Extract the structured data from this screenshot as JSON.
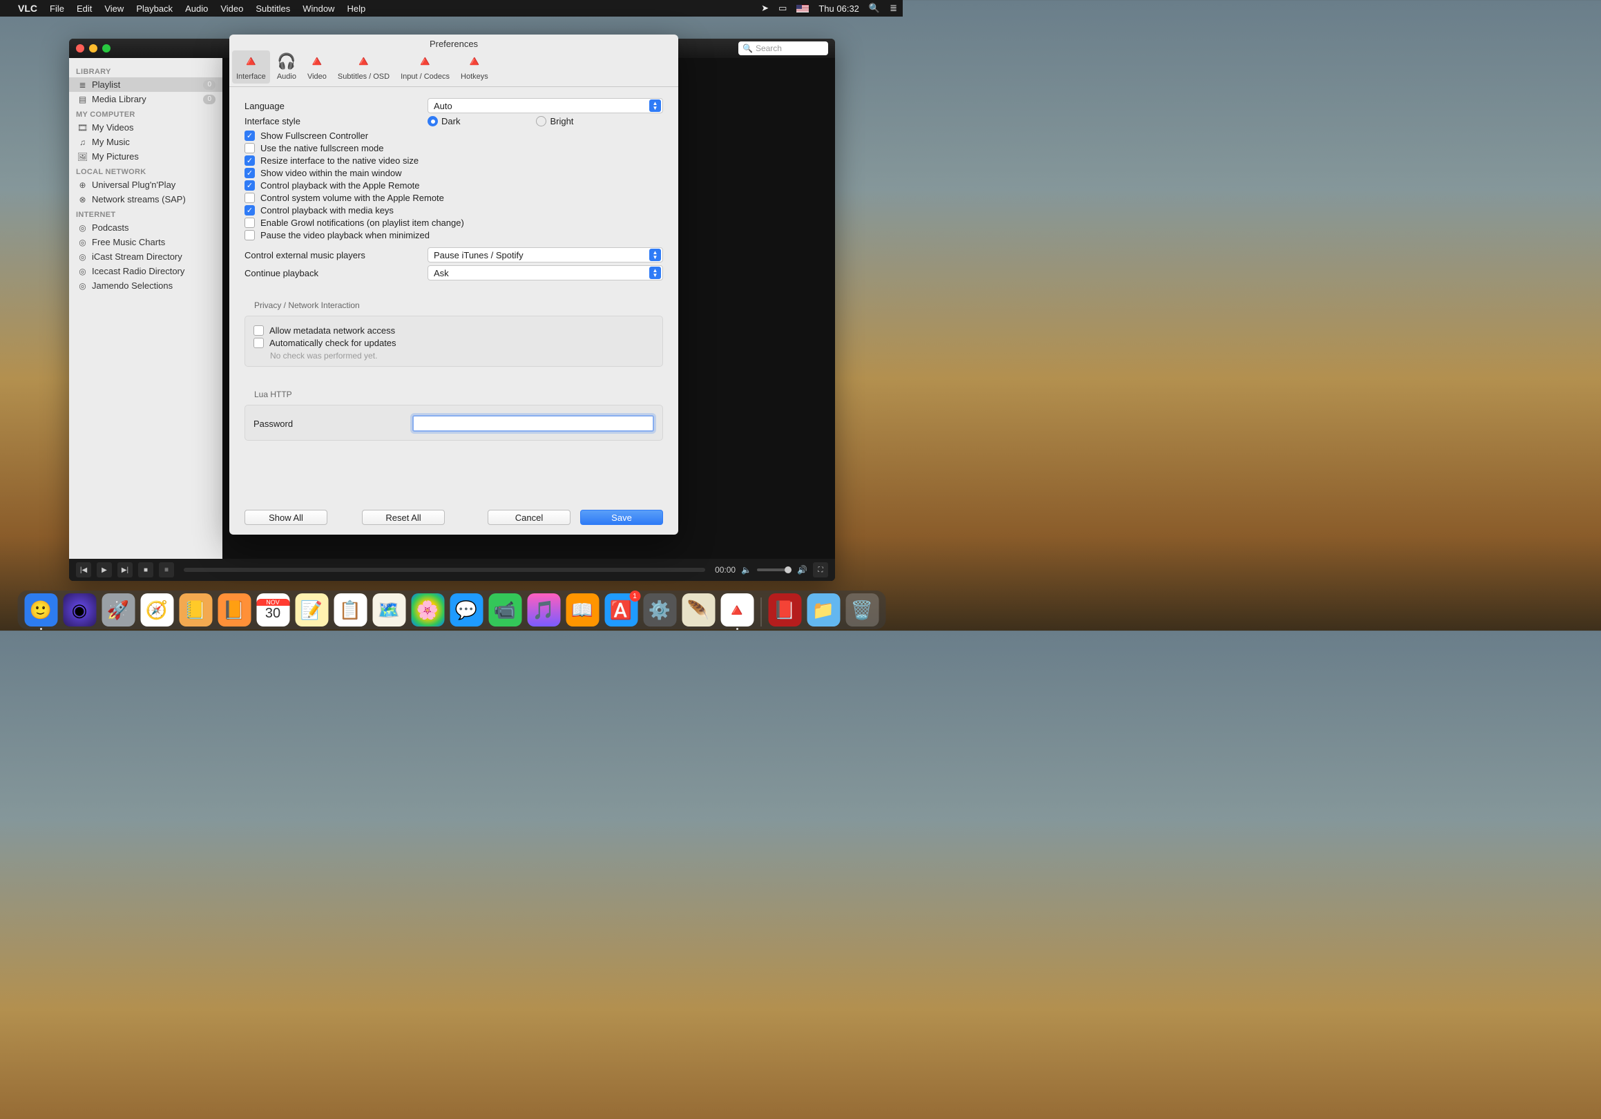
{
  "menubar": {
    "app": "VLC",
    "items": [
      "File",
      "Edit",
      "View",
      "Playback",
      "Audio",
      "Video",
      "Subtitles",
      "Window",
      "Help"
    ],
    "clock": "Thu 06:32"
  },
  "vlc": {
    "search_placeholder": "Search",
    "sidebar": {
      "sections": [
        {
          "header": "LIBRARY",
          "items": [
            {
              "label": "Playlist",
              "icon": "list-icon",
              "badge": "0",
              "selected": true
            },
            {
              "label": "Media Library",
              "icon": "library-icon",
              "badge": "0"
            }
          ]
        },
        {
          "header": "MY COMPUTER",
          "items": [
            {
              "label": "My Videos",
              "icon": "film-icon"
            },
            {
              "label": "My Music",
              "icon": "note-icon"
            },
            {
              "label": "My Pictures",
              "icon": "picture-icon"
            }
          ]
        },
        {
          "header": "LOCAL NETWORK",
          "items": [
            {
              "label": "Universal Plug'n'Play",
              "icon": "upnp-icon"
            },
            {
              "label": "Network streams (SAP)",
              "icon": "network-icon"
            }
          ]
        },
        {
          "header": "INTERNET",
          "items": [
            {
              "label": "Podcasts",
              "icon": "podcast-icon"
            },
            {
              "label": "Free Music Charts",
              "icon": "podcast-icon"
            },
            {
              "label": "iCast Stream Directory",
              "icon": "podcast-icon"
            },
            {
              "label": "Icecast Radio Directory",
              "icon": "podcast-icon"
            },
            {
              "label": "Jamendo Selections",
              "icon": "podcast-icon"
            }
          ]
        }
      ]
    },
    "controls": {
      "time": "00:00"
    }
  },
  "prefs": {
    "title": "Preferences",
    "tabs": [
      {
        "label": "Interface",
        "active": true
      },
      {
        "label": "Audio"
      },
      {
        "label": "Video"
      },
      {
        "label": "Subtitles / OSD"
      },
      {
        "label": "Input / Codecs"
      },
      {
        "label": "Hotkeys"
      }
    ],
    "language_label": "Language",
    "language_value": "Auto",
    "style_label": "Interface style",
    "style_options": {
      "dark": "Dark",
      "bright": "Bright"
    },
    "style_selected": "dark",
    "checks": [
      {
        "label": "Show Fullscreen Controller",
        "checked": true
      },
      {
        "label": "Use the native fullscreen mode",
        "checked": false
      },
      {
        "label": "Resize interface to the native video size",
        "checked": true
      },
      {
        "label": "Show video within the main window",
        "checked": true
      },
      {
        "label": "Control playback with the Apple Remote",
        "checked": true
      },
      {
        "label": "Control system volume with the Apple Remote",
        "checked": false
      },
      {
        "label": "Control playback with media keys",
        "checked": true
      },
      {
        "label": "Enable Growl notifications (on playlist item change)",
        "checked": false
      },
      {
        "label": "Pause the video playback when minimized",
        "checked": false
      }
    ],
    "ext_players_label": "Control external music players",
    "ext_players_value": "Pause iTunes / Spotify",
    "continue_label": "Continue playback",
    "continue_value": "Ask",
    "privacy_header": "Privacy / Network Interaction",
    "privacy_checks": [
      {
        "label": "Allow metadata network access",
        "checked": false
      },
      {
        "label": "Automatically check for updates",
        "checked": false
      }
    ],
    "privacy_note": "No check was performed yet.",
    "lua_header": "Lua HTTP",
    "password_label": "Password",
    "buttons": {
      "show_all": "Show All",
      "reset": "Reset All",
      "cancel": "Cancel",
      "save": "Save"
    }
  },
  "dock": {
    "badge": "1",
    "calendar_month": "NOV",
    "calendar_day": "30"
  }
}
